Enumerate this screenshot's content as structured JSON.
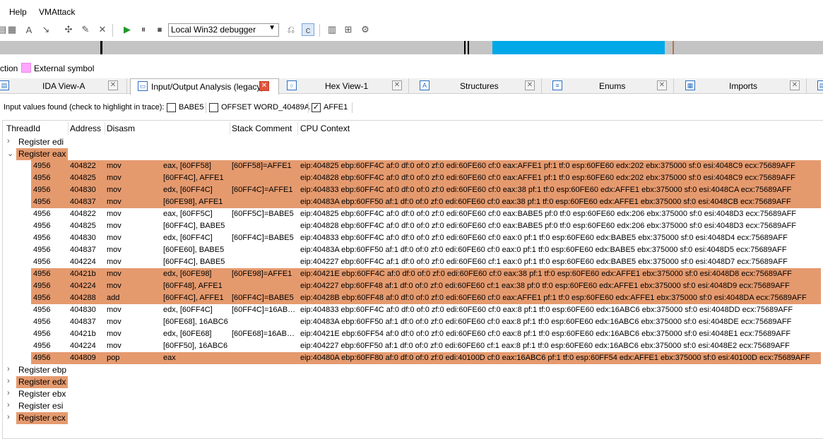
{
  "menu": [
    "Help",
    "VMAttack"
  ],
  "toolbar": {
    "debugger": "Local Win32 debugger",
    "icons": [
      "segment-icon",
      "enum-icon",
      "struct-icon",
      "arrow-icon",
      "cross-ref-icon",
      "edit-icon",
      "close-x-icon",
      "play-icon",
      "pause-icon",
      "stop-icon",
      "trace-icon",
      "step-into-icon",
      "breakpoint-list-icon",
      "tracing-icon",
      "trace-settings-icon"
    ]
  },
  "navband": {
    "colors": {
      "background": "#c4c4c4",
      "marker": "#000000",
      "code": "#00a8e8",
      "data": "#b87348"
    }
  },
  "legend": {
    "partial": "ction",
    "external": "External symbol"
  },
  "tabs": [
    {
      "label": "IDA View-A",
      "icon": "graph-icon"
    },
    {
      "label": "Input/Output Analysis (legacy)",
      "icon": "window-icon"
    },
    {
      "label": "Hex View-1",
      "icon": "hex-icon"
    },
    {
      "label": "Structures",
      "icon": "struct-icon"
    },
    {
      "label": "Enums",
      "icon": "enum-icon"
    },
    {
      "label": "Imports",
      "icon": "imports-icon"
    }
  ],
  "filter": {
    "label": "Input values found (check to highlight in trace):",
    "options": [
      {
        "label": "BABE5",
        "checked": false
      },
      {
        "label": "OFFSET WORD_40489A",
        "checked": false
      },
      {
        "label": "AFFE1",
        "checked": true
      }
    ]
  },
  "columns": [
    "ThreadId",
    "Address",
    "Disasm",
    "Stack Comment",
    "CPU Context"
  ],
  "groups_before": [
    {
      "label": "Register edi",
      "expanded": false,
      "highlight": false
    }
  ],
  "expanded_group": {
    "label": "Register eax",
    "expanded": true,
    "highlight": true
  },
  "rows": [
    {
      "tid": "4956",
      "addr": "404822",
      "op": "mov",
      "args": "eax, [60FF58]",
      "stack": "[60FF58]=AFFE1",
      "ctx": "eip:404825 ebp:60FF4C af:0 df:0 of:0 zf:0 edi:60FE60 cf:0 eax:AFFE1 pf:1 tf:0 esp:60FE60 edx:202 ebx:375000 sf:0 esi:4048C9 ecx:75689AFF",
      "hl": true
    },
    {
      "tid": "4956",
      "addr": "404825",
      "op": "mov",
      "args": "[60FF4C], AFFE1",
      "stack": "",
      "ctx": "eip:404828 ebp:60FF4C af:0 df:0 of:0 zf:0 edi:60FE60 cf:0 eax:AFFE1 pf:1 tf:0 esp:60FE60 edx:202 ebx:375000 sf:0 esi:4048C9 ecx:75689AFF",
      "hl": true
    },
    {
      "tid": "4956",
      "addr": "404830",
      "op": "mov",
      "args": "edx, [60FF4C]",
      "stack": "[60FF4C]=AFFE1",
      "ctx": "eip:404833 ebp:60FF4C af:0 df:0 of:0 zf:0 edi:60FE60 cf:0 eax:38 pf:1 tf:0 esp:60FE60 edx:AFFE1 ebx:375000 sf:0 esi:4048CA ecx:75689AFF",
      "hl": true
    },
    {
      "tid": "4956",
      "addr": "404837",
      "op": "mov",
      "args": "[60FE98], AFFE1",
      "stack": "",
      "ctx": "eip:40483A ebp:60FF50 af:1 df:0 of:0 zf:0 edi:60FE60 cf:0 eax:38 pf:1 tf:0 esp:60FE60 edx:AFFE1 ebx:375000 sf:0 esi:4048CB ecx:75689AFF",
      "hl": true
    },
    {
      "tid": "4956",
      "addr": "404822",
      "op": "mov",
      "args": "eax, [60FF5C]",
      "stack": "[60FF5C]=BABE5",
      "ctx": "eip:404825 ebp:60FF4C af:0 df:0 of:0 zf:0 edi:60FE60 cf:0 eax:BABE5 pf:0 tf:0 esp:60FE60 edx:206 ebx:375000 sf:0 esi:4048D3 ecx:75689AFF",
      "hl": false
    },
    {
      "tid": "4956",
      "addr": "404825",
      "op": "mov",
      "args": "[60FF4C], BABE5",
      "stack": "",
      "ctx": "eip:404828 ebp:60FF4C af:0 df:0 of:0 zf:0 edi:60FE60 cf:0 eax:BABE5 pf:0 tf:0 esp:60FE60 edx:206 ebx:375000 sf:0 esi:4048D3 ecx:75689AFF",
      "hl": false
    },
    {
      "tid": "4956",
      "addr": "404830",
      "op": "mov",
      "args": "edx, [60FF4C]",
      "stack": "[60FF4C]=BABE5",
      "ctx": "eip:404833 ebp:60FF4C af:0 df:0 of:0 zf:0 edi:60FE60 cf:0 eax:0 pf:1 tf:0 esp:60FE60 edx:BABE5 ebx:375000 sf:0 esi:4048D4 ecx:75689AFF",
      "hl": false
    },
    {
      "tid": "4956",
      "addr": "404837",
      "op": "mov",
      "args": "[60FE60], BABE5",
      "stack": "",
      "ctx": "eip:40483A ebp:60FF50 af:1 df:0 of:0 zf:0 edi:60FE60 cf:0 eax:0 pf:1 tf:0 esp:60FE60 edx:BABE5 ebx:375000 sf:0 esi:4048D5 ecx:75689AFF",
      "hl": false
    },
    {
      "tid": "4956",
      "addr": "404224",
      "op": "mov",
      "args": "[60FF4C], BABE5",
      "stack": "",
      "ctx": "eip:404227 ebp:60FF4C af:1 df:0 of:0 zf:0 edi:60FE60 cf:1 eax:0 pf:1 tf:0 esp:60FE60 edx:BABE5 ebx:375000 sf:0 esi:4048D7 ecx:75689AFF",
      "hl": false
    },
    {
      "tid": "4956",
      "addr": "40421b",
      "op": "mov",
      "args": "edx, [60FE98]",
      "stack": "[60FE98]=AFFE1",
      "ctx": "eip:40421E ebp:60FF4C af:0 df:0 of:0 zf:0 edi:60FE60 cf:0 eax:38 pf:1 tf:0 esp:60FE60 edx:AFFE1 ebx:375000 sf:0 esi:4048D8 ecx:75689AFF",
      "hl": true
    },
    {
      "tid": "4956",
      "addr": "404224",
      "op": "mov",
      "args": "[60FF48], AFFE1",
      "stack": "",
      "ctx": "eip:404227 ebp:60FF48 af:1 df:0 of:0 zf:0 edi:60FE60 cf:1 eax:38 pf:0 tf:0 esp:60FE60 edx:AFFE1 ebx:375000 sf:0 esi:4048D9 ecx:75689AFF",
      "hl": true
    },
    {
      "tid": "4956",
      "addr": "404288",
      "op": "add",
      "args": "[60FF4C], AFFE1",
      "stack": "[60FF4C]=BABE5",
      "ctx": "eip:40428B ebp:60FF48 af:0 df:0 of:0 zf:0 edi:60FE60 cf:0 eax:AFFE1 pf:1 tf:0 esp:60FE60 edx:AFFE1 ebx:375000 sf:0 esi:4048DA ecx:75689AFF",
      "hl": true
    },
    {
      "tid": "4956",
      "addr": "404830",
      "op": "mov",
      "args": "edx, [60FF4C]",
      "stack": "[60FF4C]=16AB…",
      "ctx": "eip:404833 ebp:60FF4C af:0 df:0 of:0 zf:0 edi:60FE60 cf:0 eax:8 pf:1 tf:0 esp:60FE60 edx:16ABC6 ebx:375000 sf:0 esi:4048DD ecx:75689AFF",
      "hl": false
    },
    {
      "tid": "4956",
      "addr": "404837",
      "op": "mov",
      "args": "[60FE68], 16ABC6",
      "stack": "",
      "ctx": "eip:40483A ebp:60FF50 af:1 df:0 of:0 zf:0 edi:60FE60 cf:0 eax:8 pf:1 tf:0 esp:60FE60 edx:16ABC6 ebx:375000 sf:0 esi:4048DE ecx:75689AFF",
      "hl": false
    },
    {
      "tid": "4956",
      "addr": "40421b",
      "op": "mov",
      "args": "edx, [60FE68]",
      "stack": "[60FE68]=16AB…",
      "ctx": "eip:40421E ebp:60FF54 af:0 df:0 of:0 zf:0 edi:60FE60 cf:0 eax:8 pf:1 tf:0 esp:60FE60 edx:16ABC6 ebx:375000 sf:0 esi:4048E1 ecx:75689AFF",
      "hl": false
    },
    {
      "tid": "4956",
      "addr": "404224",
      "op": "mov",
      "args": "[60FF50], 16ABC6",
      "stack": "",
      "ctx": "eip:404227 ebp:60FF50 af:1 df:0 of:0 zf:0 edi:60FE60 cf:1 eax:8 pf:1 tf:0 esp:60FE60 edx:16ABC6 ebx:375000 sf:0 esi:4048E2 ecx:75689AFF",
      "hl": false
    },
    {
      "tid": "4956",
      "addr": "404809",
      "op": "pop",
      "args": "eax",
      "stack": "",
      "ctx": "eip:40480A ebp:60FF80 af:0 df:0 of:0 zf:0 edi:40100D cf:0 eax:16ABC6 pf:1 tf:0 esp:60FF54 edx:AFFE1 ebx:375000 sf:0 esi:40100D ecx:75689AFF",
      "hl": true
    }
  ],
  "groups_after": [
    {
      "label": "Register ebp",
      "expanded": false,
      "highlight": false
    },
    {
      "label": "Register edx",
      "expanded": false,
      "highlight": true
    },
    {
      "label": "Register ebx",
      "expanded": false,
      "highlight": false
    },
    {
      "label": "Register esi",
      "expanded": false,
      "highlight": false
    },
    {
      "label": "Register ecx",
      "expanded": false,
      "highlight": true
    }
  ],
  "colors": {
    "highlight": "#e59a6e",
    "external_symbol": "#ffa6ff"
  }
}
